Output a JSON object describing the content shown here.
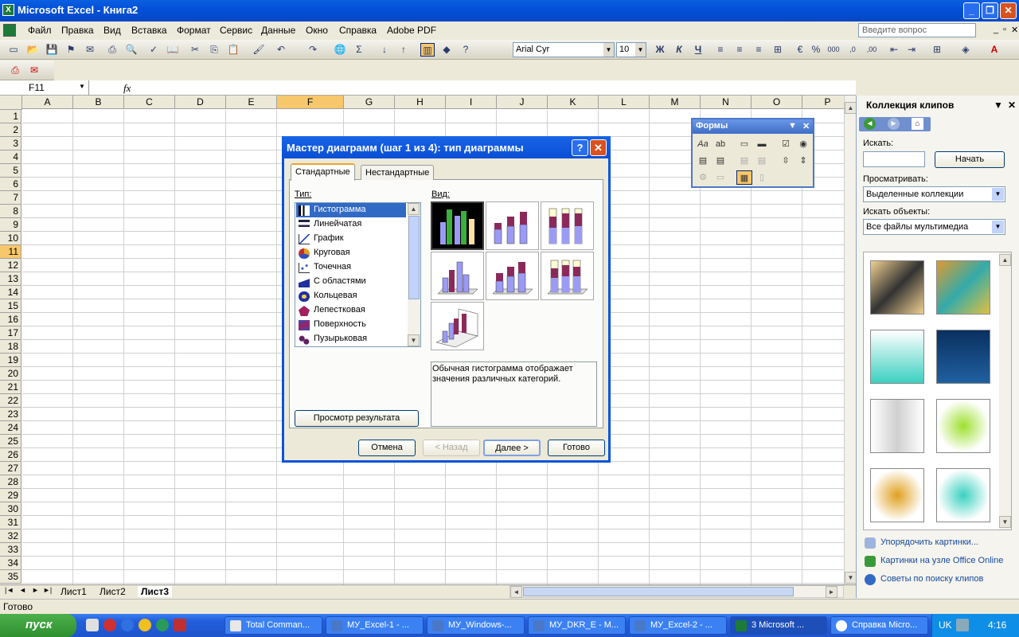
{
  "window": {
    "title": "Microsoft Excel - Книга2",
    "app_icon": "X"
  },
  "menu": {
    "items": [
      "Файл",
      "Правка",
      "Вид",
      "Вставка",
      "Формат",
      "Сервис",
      "Данные",
      "Окно",
      "Справка",
      "Adobe PDF"
    ],
    "help_placeholder": "Введите вопрос"
  },
  "format_toolbar": {
    "font": "Arial Cyr",
    "size": "10",
    "bold": "Ж",
    "italic": "К",
    "underline": "Ч"
  },
  "formula_bar": {
    "name_box": "F11",
    "fx": "fx",
    "value": ""
  },
  "grid": {
    "columns": [
      "A",
      "B",
      "C",
      "D",
      "E",
      "F",
      "G",
      "H",
      "I",
      "J",
      "K",
      "L",
      "M",
      "N",
      "O",
      "P"
    ],
    "selected_column": "F",
    "rows": [
      "1",
      "2",
      "3",
      "4",
      "5",
      "6",
      "7",
      "8",
      "9",
      "10",
      "11",
      "12",
      "13",
      "14",
      "15",
      "16",
      "17",
      "18",
      "19",
      "20",
      "21",
      "22",
      "23",
      "24",
      "25",
      "26",
      "27",
      "28",
      "29",
      "30",
      "31",
      "32",
      "33",
      "34",
      "35"
    ],
    "selected_row": "11"
  },
  "sheet_tabs": [
    "Лист1",
    "Лист2",
    "Лист3"
  ],
  "active_sheet": "Лист3",
  "status": "Готово",
  "taskbar": {
    "start": "пуск",
    "tasks": [
      "Total Comman...",
      "МУ_Excel-1 - ...",
      "МУ_Windows-...",
      "МУ_DKR_E - M...",
      "МУ_Excel-2 - ...",
      "3 Microsoft ...",
      "Справка Micro..."
    ],
    "active_task": "3 Microsoft ...",
    "lang": "UK",
    "clock": "4:16"
  },
  "task_pane": {
    "title": "Коллекция клипов",
    "search_label": "Искать:",
    "search_value": "",
    "go_button": "Начать",
    "browse_label": "Просматривать:",
    "browse_value": "Выделенные коллекции",
    "objects_label": "Искать объекты:",
    "objects_value": "Все файлы мультимедиа",
    "links": [
      "Упорядочить картинки...",
      "Картинки на узле Office Online",
      "Советы по поиску клипов"
    ]
  },
  "forms_toolbar": {
    "title": "Формы"
  },
  "dialog": {
    "title": "Мастер диаграмм (шаг 1 из 4): тип диаграммы",
    "tabs": [
      "Стандартные",
      "Нестандартные"
    ],
    "type_label": "Тип:",
    "view_label": "Вид:",
    "types": [
      "Гистограмма",
      "Линейчатая",
      "График",
      "Круговая",
      "Точечная",
      "С областями",
      "Кольцевая",
      "Лепестковая",
      "Поверхность",
      "Пузырьковая"
    ],
    "selected_type": "Гистограмма",
    "description": "Обычная гистограмма отображает значения различных категорий.",
    "preview_button": "Просмотр результата",
    "buttons": {
      "cancel": "Отмена",
      "back": "< Назад",
      "next": "Далее >",
      "finish": "Готово"
    }
  },
  "colors": {
    "accent": "#0a54d8",
    "selection": "#316ac5",
    "header_highlight": "#f7c76b",
    "bar_dark": "#8b2a5a",
    "bar_light": "#9b9bf5"
  }
}
